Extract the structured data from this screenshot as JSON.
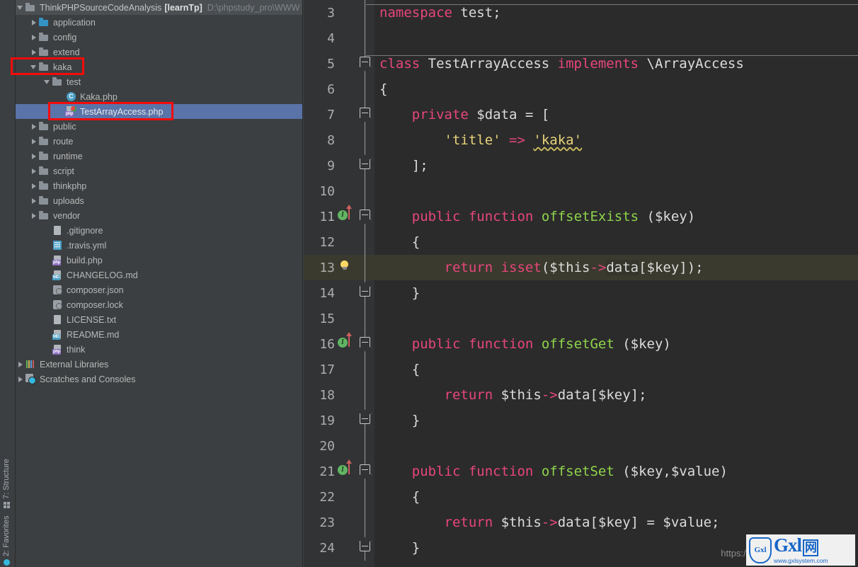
{
  "tool_strip": {
    "items": [
      {
        "label": "7: Structure",
        "icon": "structure-icon"
      },
      {
        "label": "2: Favorites",
        "icon": "favorites-icon"
      }
    ]
  },
  "project_tree": {
    "header": {
      "name": "ThinkPHPSourceCodeAnalysis",
      "module": "[learnTp]",
      "path": "D:\\phpstudy_pro\\WWW"
    },
    "items": [
      {
        "label": "application",
        "icon": "folder-blue-icon",
        "indent": 1,
        "twist": "right",
        "type": "folder-blue"
      },
      {
        "label": "config",
        "icon": "folder-icon",
        "indent": 1,
        "twist": "right",
        "type": "folder"
      },
      {
        "label": "extend",
        "icon": "folder-icon",
        "indent": 1,
        "twist": "right",
        "type": "folder"
      },
      {
        "label": "kaka",
        "icon": "folder-icon",
        "indent": 1,
        "twist": "down",
        "type": "folder"
      },
      {
        "label": "test",
        "icon": "folder-icon",
        "indent": 2,
        "twist": "down",
        "type": "folder"
      },
      {
        "label": "Kaka.php",
        "icon": "php-class-icon",
        "indent": 3,
        "twist": "none",
        "type": "phpclass"
      },
      {
        "label": "TestArrayAccess.php",
        "icon": "php-file-icon",
        "indent": 3,
        "twist": "none",
        "type": "phpfile",
        "selected": true
      },
      {
        "label": "public",
        "icon": "folder-icon",
        "indent": 1,
        "twist": "right",
        "type": "folder"
      },
      {
        "label": "route",
        "icon": "folder-icon",
        "indent": 1,
        "twist": "right",
        "type": "folder"
      },
      {
        "label": "runtime",
        "icon": "folder-icon",
        "indent": 1,
        "twist": "right",
        "type": "folder"
      },
      {
        "label": "script",
        "icon": "folder-icon",
        "indent": 1,
        "twist": "right",
        "type": "folder"
      },
      {
        "label": "thinkphp",
        "icon": "folder-icon",
        "indent": 1,
        "twist": "right",
        "type": "folder"
      },
      {
        "label": "uploads",
        "icon": "folder-icon",
        "indent": 1,
        "twist": "right",
        "type": "folder"
      },
      {
        "label": "vendor",
        "icon": "folder-icon",
        "indent": 1,
        "twist": "right",
        "type": "folder"
      },
      {
        "label": ".gitignore",
        "icon": "text-file-icon",
        "indent": 2,
        "twist": "none",
        "type": "txt"
      },
      {
        "label": ".travis.yml",
        "icon": "yaml-file-icon",
        "indent": 2,
        "twist": "none",
        "type": "yml"
      },
      {
        "label": "build.php",
        "icon": "php-file-icon",
        "indent": 2,
        "twist": "none",
        "type": "php"
      },
      {
        "label": "CHANGELOG.md",
        "icon": "markdown-file-icon",
        "indent": 2,
        "twist": "none",
        "type": "md"
      },
      {
        "label": "composer.json",
        "icon": "composer-icon",
        "indent": 2,
        "twist": "none",
        "type": "json"
      },
      {
        "label": "composer.lock",
        "icon": "composer-icon",
        "indent": 2,
        "twist": "none",
        "type": "json"
      },
      {
        "label": "LICENSE.txt",
        "icon": "text-file-icon",
        "indent": 2,
        "twist": "none",
        "type": "txt"
      },
      {
        "label": "README.md",
        "icon": "markdown-file-icon",
        "indent": 2,
        "twist": "none",
        "type": "md"
      },
      {
        "label": "think",
        "icon": "php-file-icon",
        "indent": 2,
        "twist": "none",
        "type": "php"
      },
      {
        "label": "External Libraries",
        "icon": "libraries-icon",
        "indent": 0,
        "twist": "right",
        "type": "libs"
      },
      {
        "label": "Scratches and Consoles",
        "icon": "scratches-icon",
        "indent": 0,
        "twist": "right",
        "type": "scratch"
      }
    ]
  },
  "editor": {
    "current_line": 13,
    "lines": [
      {
        "num": 3,
        "marker": null,
        "fold": "line",
        "tokens": [
          {
            "t": "namespace",
            "c": "kpink"
          },
          {
            "t": " test;",
            "c": "plain"
          }
        ]
      },
      {
        "num": 4,
        "marker": null,
        "fold": "line",
        "tokens": []
      },
      {
        "num": 5,
        "marker": null,
        "fold": "start",
        "tokens": [
          {
            "t": "class",
            "c": "kpink"
          },
          {
            "t": " TestArrayAccess ",
            "c": "plain"
          },
          {
            "t": "implements",
            "c": "kpink"
          },
          {
            "t": " \\ArrayAccess",
            "c": "plain"
          }
        ]
      },
      {
        "num": 6,
        "marker": null,
        "fold": "line",
        "tokens": [
          {
            "t": "{",
            "c": "plain"
          }
        ]
      },
      {
        "num": 7,
        "marker": null,
        "fold": "start",
        "tokens": [
          {
            "t": "    ",
            "c": "plain"
          },
          {
            "t": "private",
            "c": "kpink"
          },
          {
            "t": " $data ",
            "c": "plain"
          },
          {
            "t": "=",
            "c": "plain"
          },
          {
            "t": " [",
            "c": "plain"
          }
        ]
      },
      {
        "num": 8,
        "marker": null,
        "fold": "line",
        "tokens": [
          {
            "t": "        ",
            "c": "plain"
          },
          {
            "t": "'title'",
            "c": "str"
          },
          {
            "t": " ",
            "c": "plain"
          },
          {
            "t": "=>",
            "c": "arrow"
          },
          {
            "t": " ",
            "c": "plain"
          },
          {
            "t": "'kaka'",
            "c": "str squig"
          }
        ]
      },
      {
        "num": 9,
        "marker": null,
        "fold": "end",
        "tokens": [
          {
            "t": "    ];",
            "c": "plain"
          }
        ]
      },
      {
        "num": 10,
        "marker": null,
        "fold": "line",
        "tokens": []
      },
      {
        "num": 11,
        "marker": "impl",
        "fold": "start",
        "tokens": [
          {
            "t": "    ",
            "c": "plain"
          },
          {
            "t": "public function",
            "c": "kpink"
          },
          {
            "t": " ",
            "c": "plain"
          },
          {
            "t": "offsetExists",
            "c": "fn"
          },
          {
            "t": " ($key)",
            "c": "plain"
          }
        ]
      },
      {
        "num": 12,
        "marker": null,
        "fold": "line",
        "tokens": [
          {
            "t": "    {",
            "c": "plain"
          }
        ]
      },
      {
        "num": 13,
        "marker": "bulb",
        "fold": "line",
        "tokens": [
          {
            "t": "        ",
            "c": "plain"
          },
          {
            "t": "return",
            "c": "kpink"
          },
          {
            "t": " ",
            "c": "plain"
          },
          {
            "t": "isset",
            "c": "kpink"
          },
          {
            "t": "($this",
            "c": "plain"
          },
          {
            "t": "->",
            "c": "arrow"
          },
          {
            "t": "data",
            "c": "plain hl-ident"
          },
          {
            "t": "[$key]);",
            "c": "plain"
          }
        ]
      },
      {
        "num": 14,
        "marker": null,
        "fold": "end",
        "tokens": [
          {
            "t": "    }",
            "c": "plain"
          }
        ]
      },
      {
        "num": 15,
        "marker": null,
        "fold": "line",
        "tokens": []
      },
      {
        "num": 16,
        "marker": "impl",
        "fold": "start",
        "tokens": [
          {
            "t": "    ",
            "c": "plain"
          },
          {
            "t": "public function",
            "c": "kpink"
          },
          {
            "t": " ",
            "c": "plain"
          },
          {
            "t": "offsetGet",
            "c": "fn"
          },
          {
            "t": " ($key)",
            "c": "plain"
          }
        ]
      },
      {
        "num": 17,
        "marker": null,
        "fold": "line",
        "tokens": [
          {
            "t": "    {",
            "c": "plain"
          }
        ]
      },
      {
        "num": 18,
        "marker": null,
        "fold": "line",
        "tokens": [
          {
            "t": "        ",
            "c": "plain"
          },
          {
            "t": "return",
            "c": "kpink"
          },
          {
            "t": " $this",
            "c": "plain"
          },
          {
            "t": "->",
            "c": "arrow"
          },
          {
            "t": "data[$key];",
            "c": "plain"
          }
        ]
      },
      {
        "num": 19,
        "marker": null,
        "fold": "end",
        "tokens": [
          {
            "t": "    }",
            "c": "plain"
          }
        ]
      },
      {
        "num": 20,
        "marker": null,
        "fold": "line",
        "tokens": []
      },
      {
        "num": 21,
        "marker": "impl",
        "fold": "start",
        "tokens": [
          {
            "t": "    ",
            "c": "plain"
          },
          {
            "t": "public function",
            "c": "kpink"
          },
          {
            "t": " ",
            "c": "plain"
          },
          {
            "t": "offsetSet",
            "c": "fn"
          },
          {
            "t": " ($key,$value)",
            "c": "plain"
          }
        ]
      },
      {
        "num": 22,
        "marker": null,
        "fold": "line",
        "tokens": [
          {
            "t": "    {",
            "c": "plain"
          }
        ]
      },
      {
        "num": 23,
        "marker": null,
        "fold": "line",
        "tokens": [
          {
            "t": "        ",
            "c": "plain"
          },
          {
            "t": "return",
            "c": "kpink"
          },
          {
            "t": " $this",
            "c": "plain"
          },
          {
            "t": "->",
            "c": "arrow"
          },
          {
            "t": "data[$key] ",
            "c": "plain"
          },
          {
            "t": "=",
            "c": "plain"
          },
          {
            "t": " $value;",
            "c": "plain"
          }
        ]
      },
      {
        "num": 24,
        "marker": null,
        "fold": "end",
        "tokens": [
          {
            "t": "    }",
            "c": "plain"
          }
        ]
      }
    ]
  },
  "watermark": {
    "url": "https://blog.c",
    "logo_badge": "Gxl",
    "logo_main": "Gxl",
    "logo_cn": "网",
    "logo_sub": "www.gxlsystem.com"
  },
  "colors": {
    "panel_bg": "#3c3f41",
    "editor_bg": "#2b2b2b",
    "gutter_bg": "#313335",
    "selection": "#5a73a8",
    "current_line": "#3a3a2e",
    "annotation": "#f50b0b",
    "keyword": "#e8467c",
    "function": "#8fd44c",
    "string": "#e8d37a"
  }
}
